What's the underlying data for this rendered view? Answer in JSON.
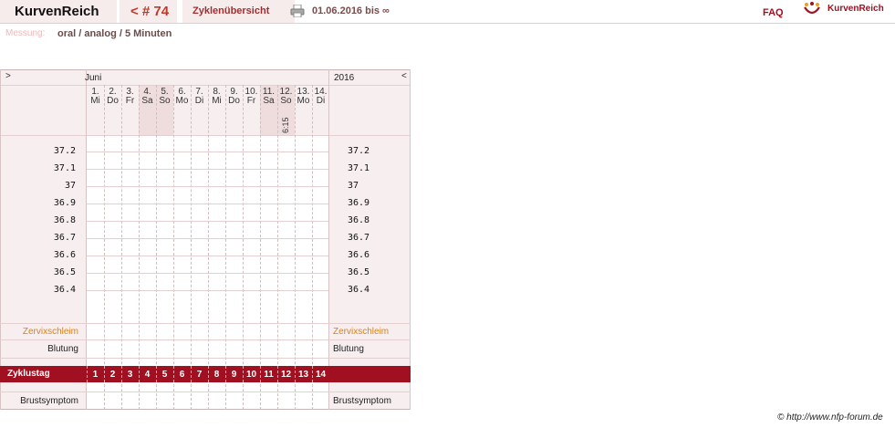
{
  "header": {
    "brand": "KurvenReich",
    "cycle": "< # 74",
    "overview": "Zyklenübersicht",
    "date_range": "01.06.2016 bis ∞",
    "faq": "FAQ",
    "logo_text": "KurvenReich"
  },
  "measurement": {
    "label": "Messung:",
    "value": "oral / analog / 5 Minuten"
  },
  "chart": {
    "nav_prev": ">",
    "nav_next": "<",
    "month": "Juni",
    "year": "2016",
    "days": [
      {
        "num": "1.",
        "name": "Mi"
      },
      {
        "num": "2.",
        "name": "Do"
      },
      {
        "num": "3.",
        "name": "Fr"
      },
      {
        "num": "4.",
        "name": "Sa"
      },
      {
        "num": "5.",
        "name": "So"
      },
      {
        "num": "6.",
        "name": "Mo"
      },
      {
        "num": "7.",
        "name": "Di"
      },
      {
        "num": "8.",
        "name": "Mi"
      },
      {
        "num": "9.",
        "name": "Do"
      },
      {
        "num": "10.",
        "name": "Fr"
      },
      {
        "num": "11.",
        "name": "Sa"
      },
      {
        "num": "12.",
        "name": "So"
      },
      {
        "num": "13.",
        "name": "Mo"
      },
      {
        "num": "14.",
        "name": "Di"
      }
    ],
    "time_label": "6:15",
    "temperatures": [
      "37.2",
      "37.1",
      "37",
      "36.9",
      "36.8",
      "36.7",
      "36.6",
      "36.5",
      "36.4"
    ],
    "rows": {
      "cervix": "Zervixschleim",
      "bleeding": "Blutung",
      "cycle_day": "Zyklustag",
      "breast": "Brustsymptom"
    },
    "cycle_days": [
      "1",
      "2",
      "3",
      "4",
      "5",
      "6",
      "7",
      "8",
      "9",
      "10",
      "11",
      "12",
      "13",
      "14"
    ]
  },
  "footer": {
    "copyright": "© http://www.nfp-forum.de"
  },
  "colors": {
    "accent": "#a01020",
    "tab_bg": "#f7ecec",
    "label_orange": "#d9801c"
  }
}
